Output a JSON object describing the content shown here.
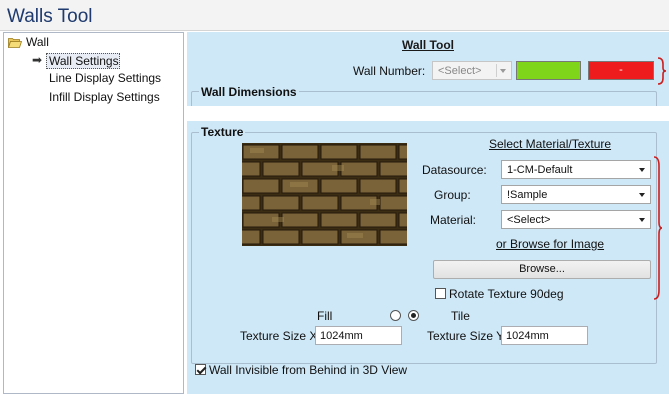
{
  "window": {
    "title": "Walls Tool"
  },
  "tree": {
    "root": {
      "label": "Wall",
      "icon": "folder-open-icon"
    },
    "items": [
      {
        "label": "Wall Settings",
        "selected": true,
        "icon": "arrow-right-icon"
      },
      {
        "label": "Line Display Settings"
      },
      {
        "label": "Infill Display Settings"
      }
    ]
  },
  "wall_tool": {
    "heading": "Wall Tool",
    "wall_number_label": "Wall Number:",
    "wall_number_value": "<Select>",
    "swatch_green": "#7ed51a",
    "swatch_red": "#ee1c1c",
    "swatch_red_text": "-"
  },
  "wall_dimensions": {
    "heading": "Wall Dimensions"
  },
  "texture": {
    "heading": "Texture",
    "select_link": "Select Material/Texture",
    "datasource_label": "Datasource:",
    "datasource_value": "1-CM-Default",
    "group_label": "Group:",
    "group_value": "!Sample",
    "material_label": "Material:",
    "material_value": "<Select>",
    "browse_link": "or Browse for Image",
    "browse_button": "Browse...",
    "rotate_label": "Rotate Texture 90deg",
    "rotate_checked": false,
    "fill_label": "Fill",
    "tile_label": "Tile",
    "fill_selected": false,
    "tile_selected": true,
    "size_x_label": "Texture Size X",
    "size_x_value": "1024mm",
    "size_y_label": "Texture Size Y",
    "size_y_value": "1024mm"
  },
  "invisible_option": {
    "label": "Wall Invisible from Behind in 3D View",
    "checked": true
  },
  "colors": {
    "panel_bg": "#cfe8f7",
    "title_text": "#1e3a6e",
    "annotation_red": "#cc1f1f"
  }
}
